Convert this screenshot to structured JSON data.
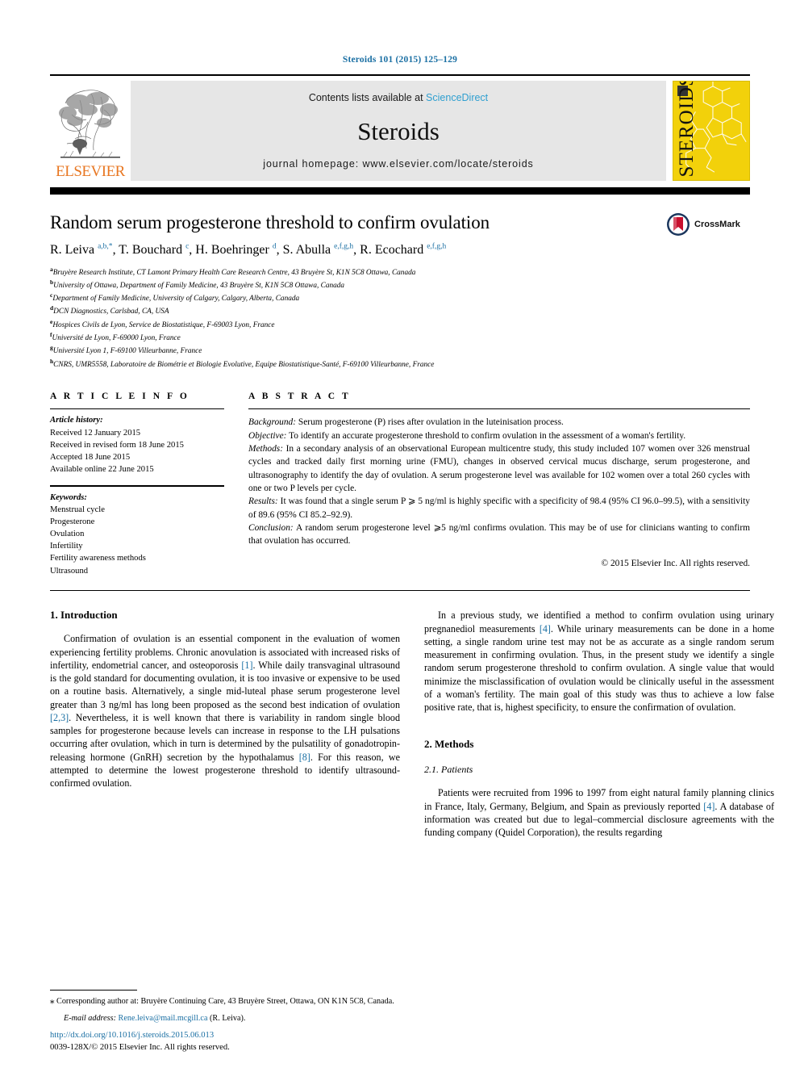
{
  "running_head": "Steroids 101 (2015) 125–129",
  "masthead": {
    "contents_prefix": "Contents lists available at ",
    "sciencedirect": "ScienceDirect",
    "journal_name": "Steroids",
    "homepage": "journal homepage: www.elsevier.com/locate/steroids",
    "publisher_word": "ELSEVIER",
    "cover_title": "STEROIDS",
    "accent_link_color": "#2f9fd0",
    "publisher_color": "#e87722",
    "cover_color": "#f2d10b"
  },
  "article": {
    "title": "Random serum progesterone threshold to confirm ovulation",
    "authors_html": "R. Leiva <sup>a,b,*</sup>, T. Bouchard <sup>c</sup>, H. Boehringer <sup>d</sup>, S. Abulla <sup>e,f,g,h</sup>, R. Ecochard <sup>e,f,g,h</sup>",
    "crossmark_label": "CrossMark",
    "affiliations": [
      {
        "mark": "a",
        "text": "Bruyère Research Institute, CT Lamont Primary Health Care Research Centre, 43 Bruyère St, K1N 5C8 Ottawa, Canada"
      },
      {
        "mark": "b",
        "text": "University of Ottawa, Department of Family Medicine, 43 Bruyère St, K1N 5C8 Ottawa, Canada"
      },
      {
        "mark": "c",
        "text": "Department of Family Medicine, University of Calgary, Calgary, Alberta, Canada"
      },
      {
        "mark": "d",
        "text": "DCN Diagnostics, Carlsbad, CA, USA"
      },
      {
        "mark": "e",
        "text": "Hospices Civils de Lyon, Service de Biostatistique, F-69003 Lyon, France"
      },
      {
        "mark": "f",
        "text": "Université de Lyon, F-69000 Lyon, France"
      },
      {
        "mark": "g",
        "text": "Université Lyon 1, F-69100 Villeurbanne, France"
      },
      {
        "mark": "h",
        "text": "CNRS, UMR5558, Laboratoire de Biométrie et Biologie Evolutive, Equipe Biostatistique-Santé, F-69100 Villeurbanne, France"
      }
    ]
  },
  "article_info": {
    "heading": "A R T I C L E   I N F O",
    "history_label": "Article history:",
    "history": [
      "Received 12 January 2015",
      "Received in revised form 18 June 2015",
      "Accepted 18 June 2015",
      "Available online 22 June 2015"
    ],
    "keywords_label": "Keywords:",
    "keywords": [
      "Menstrual cycle",
      "Progesterone",
      "Ovulation",
      "Infertility",
      "Fertility awareness methods",
      "Ultrasound"
    ]
  },
  "abstract": {
    "heading": "A B S T R A C T",
    "sections": [
      {
        "label": "Background:",
        "text": " Serum progesterone (P) rises after ovulation in the luteinisation process."
      },
      {
        "label": "Objective:",
        "text": " To identify an accurate progesterone threshold to confirm ovulation in the assessment of a woman's fertility."
      },
      {
        "label": "Methods:",
        "text": " In a secondary analysis of an observational European multicentre study, this study included 107 women over 326 menstrual cycles and tracked daily first morning urine (FMU), changes in observed cervical mucus discharge, serum progesterone, and ultrasonography to identify the day of ovulation. A serum progesterone level was available for 102 women over a total 260 cycles with one or two P levels per cycle."
      },
      {
        "label": "Results:",
        "text": " It was found that a single serum P ⩾ 5 ng/ml is highly specific with a specificity of 98.4 (95% CI 96.0–99.5), with a sensitivity of 89.6 (95% CI 85.2–92.9)."
      },
      {
        "label": "Conclusion:",
        "text": " A random serum progesterone level ⩾5 ng/ml confirms ovulation. This may be of use for clinicians wanting to confirm that ovulation has occurred."
      }
    ],
    "copyright": "© 2015 Elsevier Inc. All rights reserved."
  },
  "body": {
    "intro_heading": "1. Introduction",
    "intro_paragraph_1": "Confirmation of ovulation is an essential component in the evaluation of women experiencing fertility problems. Chronic anovulation is associated with increased risks of infertility, endometrial cancer, and osteoporosis [1]. While daily transvaginal ultrasound is the gold standard for documenting ovulation, it is too invasive or expensive to be used on a routine basis. Alternatively, a single mid-luteal phase serum progesterone level greater than 3 ng/ml has long been proposed as the second best indication of ovulation [2,3]. Nevertheless, it is well known that there is variability in random single blood samples for progesterone because levels can increase in response to the LH pulsations occurring after ovulation, which in turn is determined by the pulsatility of gonadotropin-releasing hormone (GnRH) secretion by the hypothalamus [8]. For this reason, we attempted to determine the lowest progesterone threshold to identify ultrasound-confirmed ovulation.",
    "intro_paragraph_2": "In a previous study, we identified a method to confirm ovulation using urinary pregnanediol measurements [4]. While urinary measurements can be done in a home setting, a single random urine test may not be as accurate as a single random serum measurement in confirming ovulation. Thus, in the present study we identify a single random serum progesterone threshold to confirm ovulation. A single value that would minimize the misclassification of ovulation would be clinically useful in the assessment of a woman's fertility. The main goal of this study was thus to achieve a low false positive rate, that is, highest specificity, to ensure the confirmation of ovulation.",
    "methods_heading": "2. Methods",
    "patients_heading": "2.1. Patients",
    "patients_paragraph": "Patients were recruited from 1996 to 1997 from eight natural family planning clinics in France, Italy, Germany, Belgium, and Spain as previously reported [4]. A database of information was created but due to legal–commercial disclosure agreements with the funding company (Quidel Corporation), the results regarding"
  },
  "footer": {
    "corresponding_star": "⁎",
    "corresponding_text": " Corresponding author at: Bruyère Continuing Care, 43 Bruyère Street, Ottawa, ON K1N 5C8, Canada.",
    "email_label": "E-mail address:",
    "email": "Rene.leiva@mail.mcgill.ca",
    "email_suffix": " (R. Leiva).",
    "doi": "http://dx.doi.org/10.1016/j.steroids.2015.06.013",
    "issn_line": "0039-128X/© 2015 Elsevier Inc. All rights reserved."
  }
}
